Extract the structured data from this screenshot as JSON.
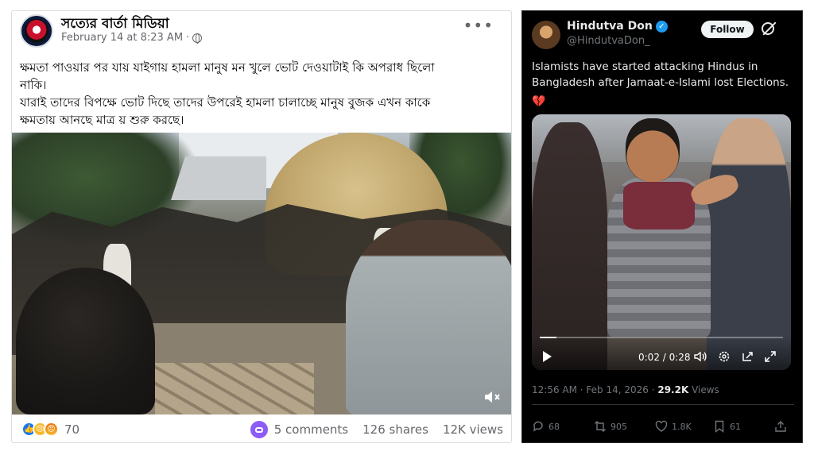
{
  "facebook": {
    "page_name": "সত্যের বার্তা মিডিয়া",
    "timestamp": "February 14 at 8:23 AM",
    "more_label": "•••",
    "text_lines": [
      "ক্ষমতা পাওয়ার পর যায় যাইগায় হামলা মানুষ মন খুলে ভোট দেওয়াটাই কি অপরাধ ছিলো",
      "নাকি।",
      "যারাই তাদের বিপক্ষে ভোট দিছে তাদের উপরেই হামলা চালাচ্ছে মানুষ বুজক এখন কাকে",
      "ক্ষমতায় আনছে মাত্র য় শুরু করছে।"
    ],
    "reaction_count": "70",
    "comments": "5 comments",
    "shares": "126 shares",
    "views": "12K views",
    "reactions": [
      "like-icon",
      "sad-icon",
      "angry-icon"
    ]
  },
  "twitter": {
    "display_name": "Hindutva Don",
    "handle": "@HindutvaDon_",
    "follow_label": "Follow",
    "tweet_text": "Islamists have started attacking Hindus in Bangladesh after Jamaat-e-Islami lost Elections.",
    "emoji": "💔",
    "video_time": "0:02 / 0:28",
    "video_progress": 0.07,
    "timestamp": "12:56 AM · Feb 14, 2026 · ",
    "views_count": "29.2K",
    "views_label": " Views",
    "replies": "68",
    "reposts": "905",
    "likes": "1.8K",
    "bookmarks": "61",
    "accent": "#1d9bf0"
  }
}
